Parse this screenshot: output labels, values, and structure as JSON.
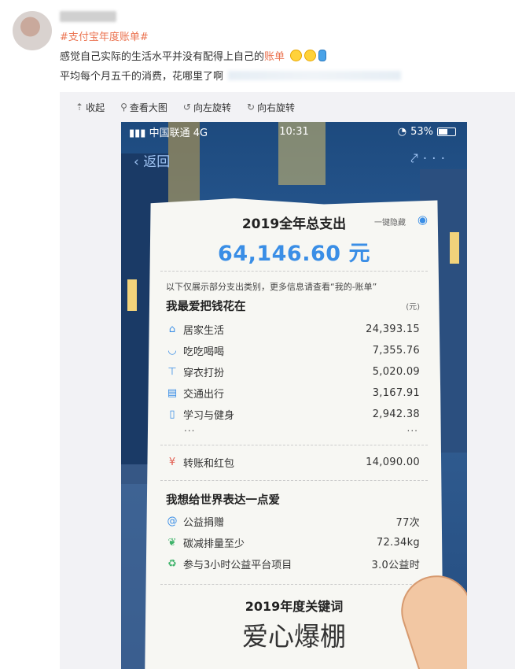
{
  "post": {
    "hashtag": "#支付宝年度账单#",
    "line1_text": "感觉自己实际的生活水平并没有配得上自己的",
    "line1_highlight": "账单",
    "line2_text": "平均每个月五千的消费，花哪里了啊"
  },
  "toolbar": {
    "collapse": "收起",
    "view_large": "查看大图",
    "rotate_left": "向左旋转",
    "rotate_right": "向右旋转"
  },
  "status_bar": {
    "carrier": "中国联通",
    "network": "4G",
    "time": "10:31",
    "battery": "53%"
  },
  "nav": {
    "back": "返回"
  },
  "receipt": {
    "title": "2019全年总支出",
    "hide_label": "一键隐藏",
    "total": "64,146.60 元",
    "note": "以下仅展示部分支出类别，更多信息请查看“我的-账单”",
    "section1": "我最爱把钱花在",
    "unit": "(元)",
    "categories": [
      {
        "label": "居家生活",
        "value": "24,393.15",
        "icon": "home-icon"
      },
      {
        "label": "吃吃喝喝",
        "value": "7,355.76",
        "icon": "bowl-icon"
      },
      {
        "label": "穿衣打扮",
        "value": "5,020.09",
        "icon": "shirt-icon"
      },
      {
        "label": "交通出行",
        "value": "3,167.91",
        "icon": "bus-icon"
      },
      {
        "label": "学习与健身",
        "value": "2,942.38",
        "icon": "book-icon"
      }
    ],
    "ellipsis": "...",
    "transfer": {
      "label": "转账和红包",
      "value": "14,090.00",
      "icon": "red-envelope-icon"
    },
    "section2": "我想给世界表达一点爱",
    "love": [
      {
        "label": "公益捐赠",
        "value": "77次",
        "icon": "charity-icon"
      },
      {
        "label": "碳减排量至少",
        "value": "72.34kg",
        "icon": "leaf-icon"
      },
      {
        "label": "参与3小时公益平台项目",
        "value": "3.0公益时",
        "icon": "recycle-icon"
      }
    ],
    "keyword_title": "2019年度关键词",
    "keyword": "爱心爆棚"
  }
}
